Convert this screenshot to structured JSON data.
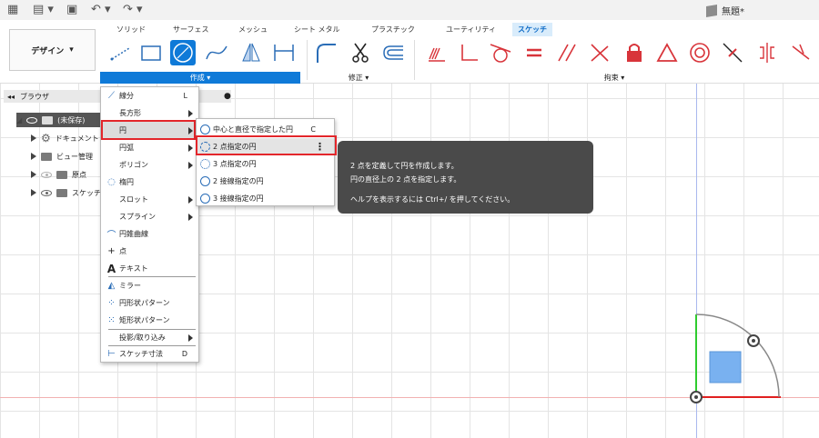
{
  "top_bar": {
    "doc_title": "無題*"
  },
  "tabs": [
    "ソリッド",
    "サーフェス",
    "メッシュ",
    "シート メタル",
    "プラスチック",
    "ユーティリティ",
    "スケッチ"
  ],
  "active_tab": "スケッチ",
  "design_button": {
    "label": "デザイン",
    "icon": "chevron-down-icon"
  },
  "groups": {
    "create": "作成 ▾",
    "modify": "修正 ▾",
    "constraints": "拘束 ▾"
  },
  "browser": {
    "title": "ブラウザ",
    "items": [
      {
        "label": "(未保存)"
      },
      {
        "label": "ドキュメント"
      },
      {
        "label": "ビュー管理"
      },
      {
        "label": "原点"
      },
      {
        "label": "スケッチ"
      }
    ]
  },
  "create_menu": [
    {
      "label": "線分",
      "shortcut": "L",
      "icon": "line-icon"
    },
    {
      "label": "長方形",
      "submenu": true,
      "icon": "rectangle-icon"
    },
    {
      "label": "円",
      "submenu": true,
      "icon": "circle-icon"
    },
    {
      "label": "円弧",
      "submenu": true,
      "icon": "arc-icon"
    },
    {
      "label": "ポリゴン",
      "submenu": true,
      "icon": "polygon-icon"
    },
    {
      "label": "楕円",
      "icon": "ellipse-icon"
    },
    {
      "label": "スロット",
      "submenu": true,
      "icon": "slot-icon"
    },
    {
      "label": "スプライン",
      "submenu": true,
      "icon": "spline-icon"
    },
    {
      "label": "円錐曲線",
      "icon": "conic-icon"
    },
    {
      "label": "点",
      "icon": "point-icon"
    },
    {
      "label": "テキスト",
      "icon": "text-icon"
    },
    {
      "label": "ミラー",
      "icon": "mirror-icon"
    },
    {
      "label": "円形状パターン",
      "icon": "circular-pattern-icon"
    },
    {
      "label": "矩形状パターン",
      "icon": "rectangular-pattern-icon"
    },
    {
      "label": "投影/取り込み",
      "submenu": true,
      "icon": "project-icon"
    },
    {
      "label": "スケッチ寸法",
      "shortcut": "D",
      "icon": "dimension-icon"
    }
  ],
  "circle_menu": [
    {
      "label": "中心と直径で指定した円",
      "shortcut": "C"
    },
    {
      "label": "2 点指定の円"
    },
    {
      "label": "3 点指定の円"
    },
    {
      "label": "2 接線指定の円"
    },
    {
      "label": "3 接線指定の円"
    }
  ],
  "tooltip": {
    "line1": "2 点を定義して円を作成します。",
    "line2": "円の直径上の 2 点を指定します。",
    "line3": "ヘルプを表示するには Ctrl+/ を押してください。"
  },
  "colors": {
    "accent": "#0f7ad8",
    "highlight_box": "#e3262b",
    "constraint_red": "#d8343a",
    "tooltip_bg": "#4a4a4a"
  }
}
